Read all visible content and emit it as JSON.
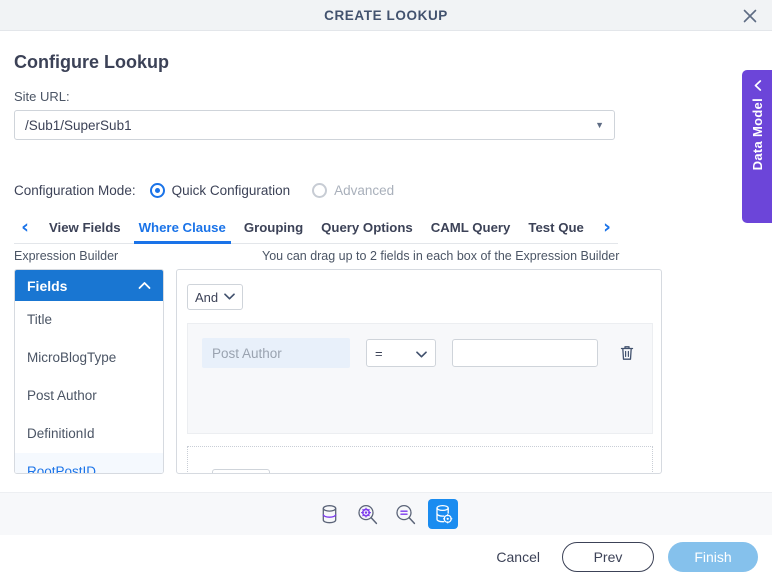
{
  "titlebar": {
    "title": "CREATE LOOKUP",
    "close_icon": "close-icon"
  },
  "page": {
    "heading": "Configure Lookup"
  },
  "site_url": {
    "label": "Site URL:",
    "value": "/Sub1/SuperSub1",
    "caret": "▼"
  },
  "config_mode": {
    "label": "Configuration Mode:",
    "options": [
      {
        "label": "Quick Configuration",
        "selected": true,
        "disabled": false
      },
      {
        "label": "Advanced",
        "selected": false,
        "disabled": true
      }
    ]
  },
  "tabs": {
    "prev_arrow": "‹",
    "next_arrow": "›",
    "items": [
      {
        "label": "View Fields",
        "active": false
      },
      {
        "label": "Where Clause",
        "active": true
      },
      {
        "label": "Grouping",
        "active": false
      },
      {
        "label": "Query Options",
        "active": false
      },
      {
        "label": "CAML Query",
        "active": false
      },
      {
        "label": "Test Que",
        "active": false
      }
    ]
  },
  "expression_builder": {
    "label": "Expression Builder",
    "hint": "You can drag up to 2 fields in each box of the Expression Builder",
    "logic_operator": "And",
    "logic_caret": "⌄",
    "condition": {
      "field": "Post Author",
      "operator": "=",
      "operator_caret": "⌄",
      "value": "",
      "value_placeholder": "",
      "delete_icon": "trash-icon"
    }
  },
  "fields_panel": {
    "header": "Fields",
    "collapse_icon": "⌃",
    "items": [
      {
        "label": "Title",
        "hover": false
      },
      {
        "label": "MicroBlogType",
        "hover": false
      },
      {
        "label": "Post Author",
        "hover": false
      },
      {
        "label": "DefinitionId",
        "hover": false
      },
      {
        "label": "RootPostID",
        "hover": true
      }
    ]
  },
  "data_model": {
    "label": "Data Model",
    "chevron": "‹",
    "color": "#6c45d9"
  },
  "icon_toolbar": {
    "items": [
      {
        "name": "database-icon",
        "active": false
      },
      {
        "name": "search-settings-icon",
        "active": false
      },
      {
        "name": "search-equals-icon",
        "active": false
      },
      {
        "name": "database-settings-icon",
        "active": true
      }
    ]
  },
  "footer": {
    "cancel": "Cancel",
    "prev": "Prev",
    "finish": "Finish"
  },
  "colors": {
    "accent_blue": "#1a73e8",
    "header_blue": "#1976d2",
    "purple": "#6c45d9",
    "finish_blue": "#85c1ec",
    "titlebar_bg": "#f1f3f5"
  }
}
